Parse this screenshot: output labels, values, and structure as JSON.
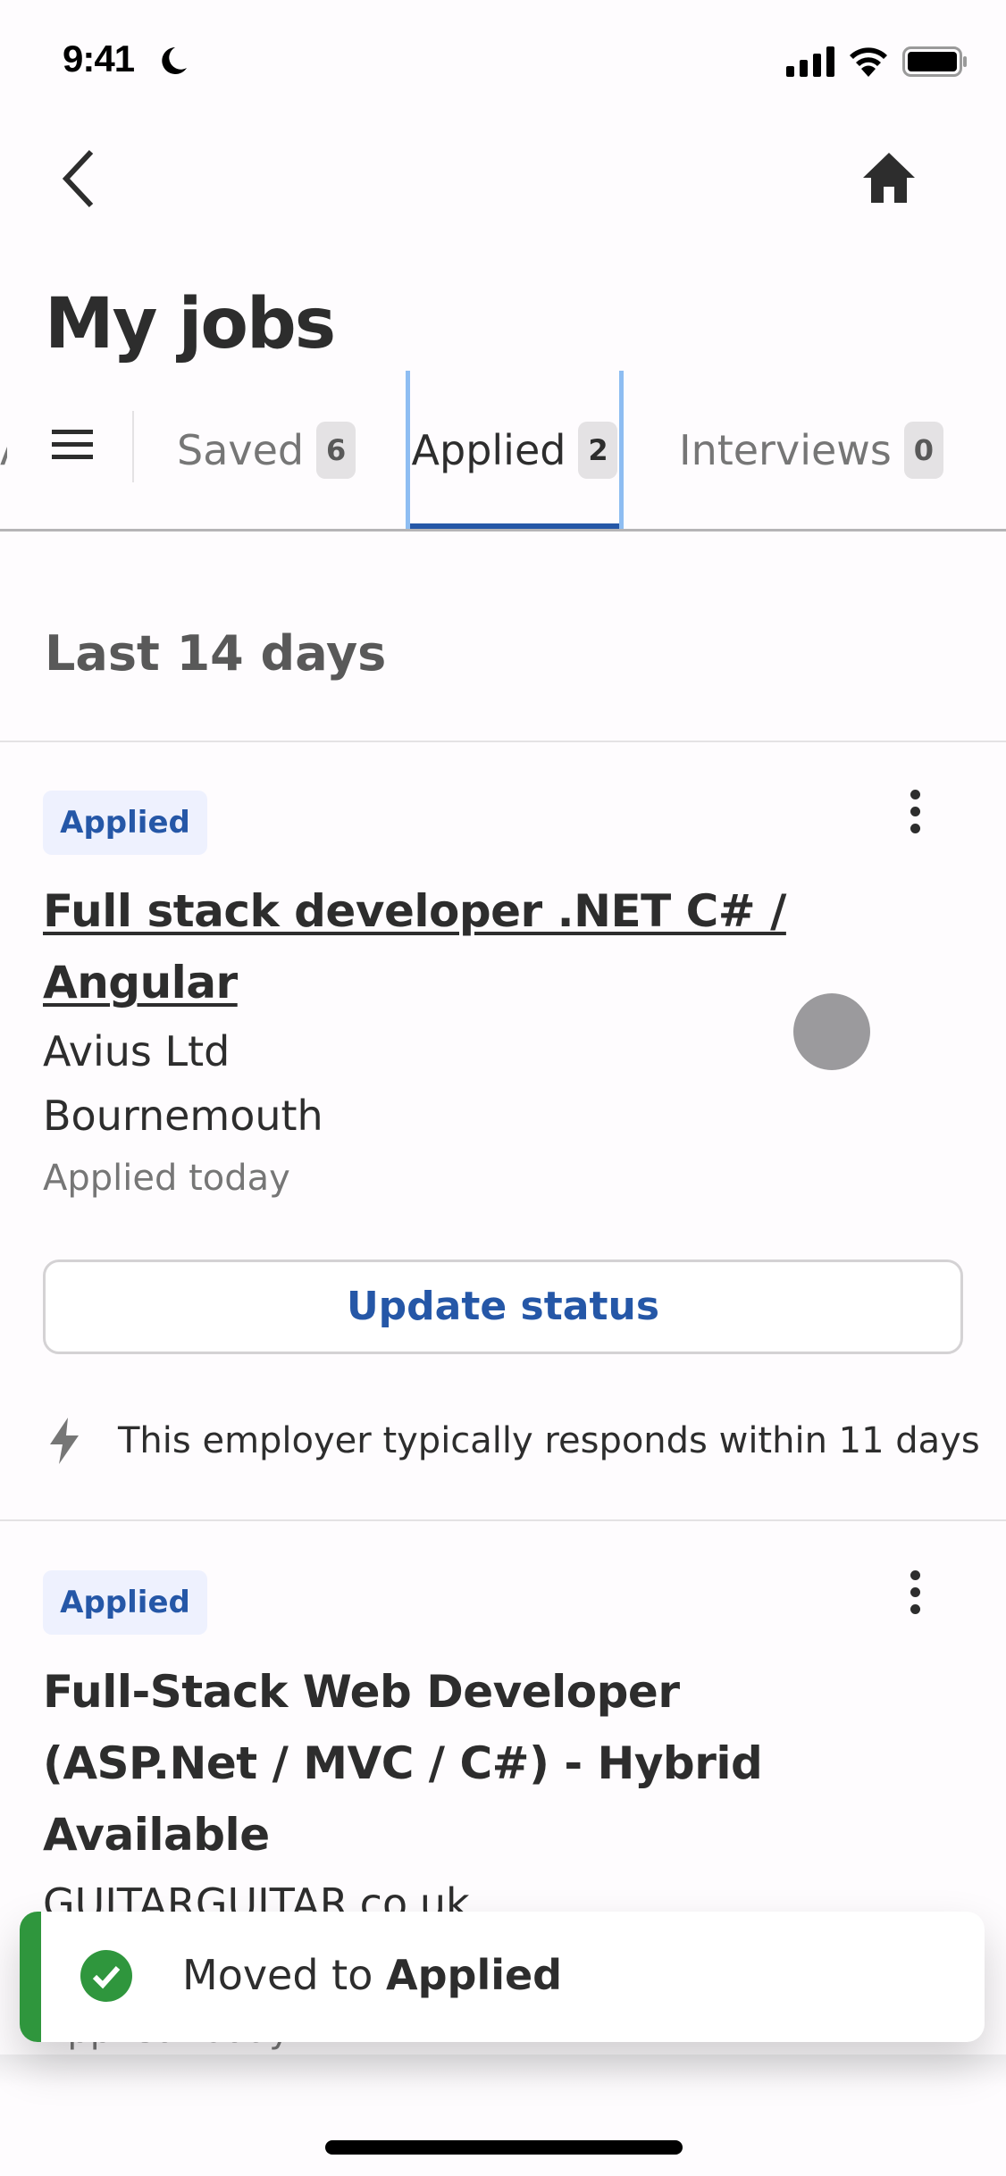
{
  "status_bar": {
    "time": "9:41",
    "focus_icon": "moon-icon",
    "signal_icon": "cellular-signal-icon",
    "wifi_icon": "wifi-icon",
    "battery_icon": "battery-icon"
  },
  "nav": {
    "back_icon": "chevron-left-icon",
    "home_icon": "home-icon"
  },
  "page": {
    "title": "My jobs"
  },
  "tabs": {
    "menu_icon": "hamburger-menu-icon",
    "items": [
      {
        "label": "Saved",
        "count": "6",
        "active": false
      },
      {
        "label": "Applied",
        "count": "2",
        "active": true
      },
      {
        "label": "Interviews",
        "count": "0",
        "active": false
      },
      {
        "label": "A",
        "count": "",
        "active": false
      }
    ]
  },
  "section": {
    "heading": "Last 14 days"
  },
  "jobs": [
    {
      "status_badge": "Applied",
      "title": "Full stack developer .NET C# / Angular",
      "company": "Avius Ltd",
      "location": "Bournemouth",
      "applied_when": "Applied today",
      "update_button": "Update status",
      "response_note": "This employer typically responds within 11 days"
    },
    {
      "status_badge": "Applied",
      "title": "Full-Stack Web Developer (ASP.Net / MVC / C#) - Hybrid Available",
      "company": "GUITARGUITAR.co.uk",
      "applied_when": "Applied today"
    }
  ],
  "toast": {
    "prefix": "Moved to ",
    "emphasis": "Applied",
    "icon": "check-circle-icon",
    "accent_color": "#2f963d"
  },
  "colors": {
    "brand_blue": "#2557a7",
    "tab_focus": "#8ebdf2",
    "badge_bg": "#eef1fe",
    "text": "#2d2d2d",
    "muted": "#767676"
  }
}
